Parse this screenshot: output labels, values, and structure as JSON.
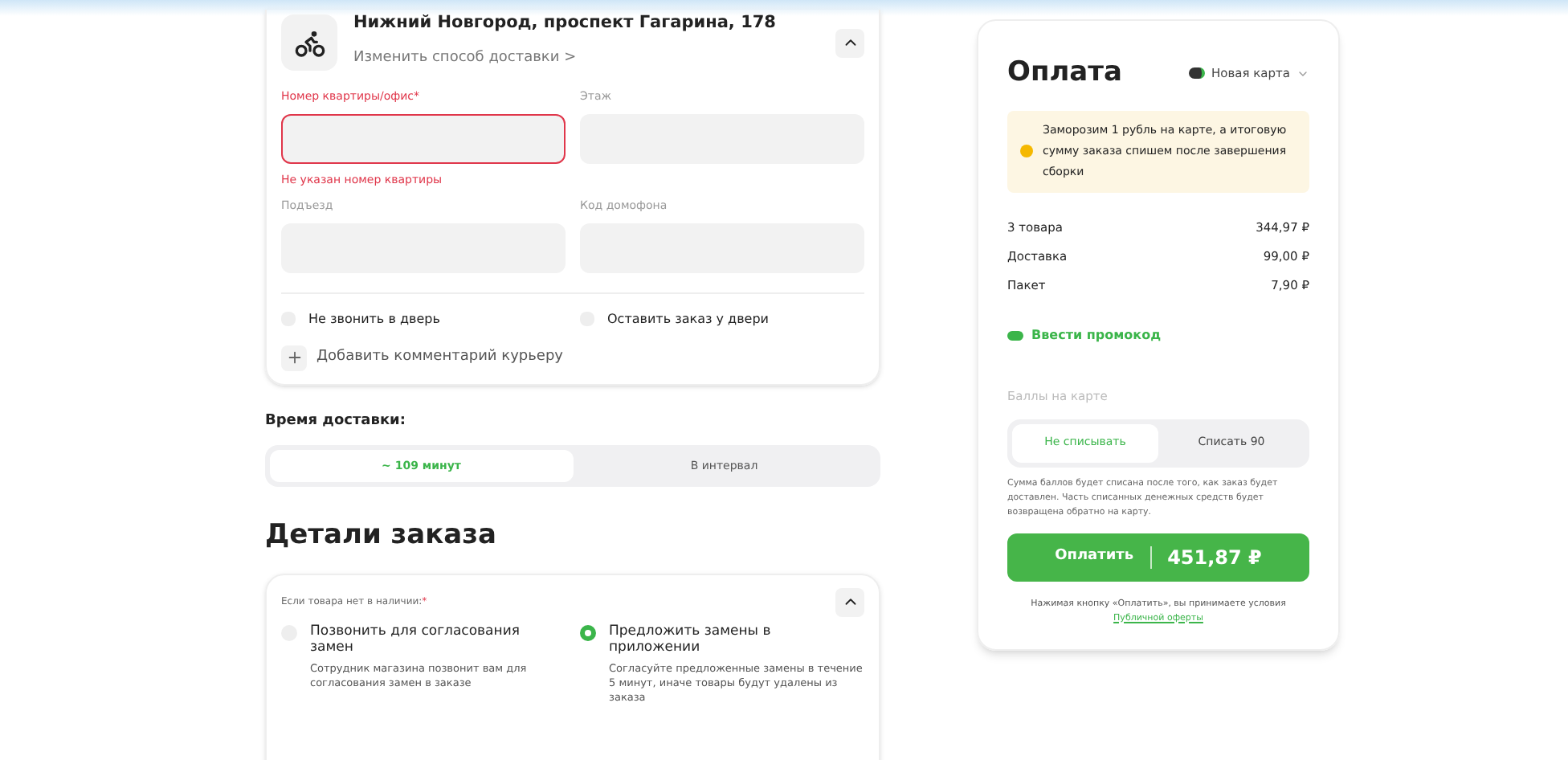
{
  "delivery": {
    "address": "Нижний Новгород, проспект Гагарина, 178",
    "change_link": "Изменить способ доставки",
    "change_arrow": ">",
    "fields": [
      {
        "label": "Номер квартиры/офис",
        "required": "*",
        "error": "Не указан номер квартиры",
        "invalid": true
      },
      {
        "label": "Этаж",
        "invalid": false
      },
      {
        "label": "Подъезд",
        "invalid": false
      },
      {
        "label": "Код домофона",
        "invalid": false
      }
    ],
    "checkboxes": [
      {
        "label": "Не звонить в дверь",
        "checked": false
      },
      {
        "label": "Оставить заказ у двери",
        "checked": false
      }
    ],
    "add_comment": "Добавить комментарий курьеру"
  },
  "delivery_time": {
    "title": "Время доставки:",
    "options": [
      {
        "label": "~ 109 минут",
        "selected": true
      },
      {
        "label": "В интервал",
        "selected": false
      }
    ]
  },
  "order_details": {
    "title": "Детали заказа",
    "question": "Если товара нет в наличии:",
    "required": "*",
    "options": [
      {
        "title": "Позвонить для согласования замен",
        "text": "Сотрудник магазина позвонит вам для согласования замен в заказе",
        "selected": false
      },
      {
        "title": "Предложить замены в приложении",
        "text": "Согласуйте предложенные замены в течение 5 минут, иначе товары будут удалены из заказа",
        "selected": true
      }
    ]
  },
  "payment": {
    "title": "Оплата",
    "method": "Новая карта",
    "notice": "Заморозим 1 рубль на карте, а итоговую сумму заказа спишем после завершения сборки",
    "lines": [
      {
        "label": "3 товара",
        "value": "344,97 ₽"
      },
      {
        "label": "Доставка",
        "value": "99,00 ₽"
      },
      {
        "label": "Пакет",
        "value": "7,90 ₽"
      }
    ],
    "promo": "Ввести промокод",
    "points_label": "Баллы на карте",
    "points_options": [
      {
        "label": "Не списывать",
        "selected": true
      },
      {
        "label": "Списать 90",
        "selected": false
      }
    ],
    "points_note": "Сумма баллов будет списана после того, как заказ будет доставлен. Часть списанных денежных средств будет возвращена обратно на карту.",
    "pay_label": "Оплатить",
    "pay_total": "451,87 ₽",
    "terms": "Нажимая кнопку «Оплатить», вы принимаете условия",
    "terms_link": "Публичной оферты"
  }
}
